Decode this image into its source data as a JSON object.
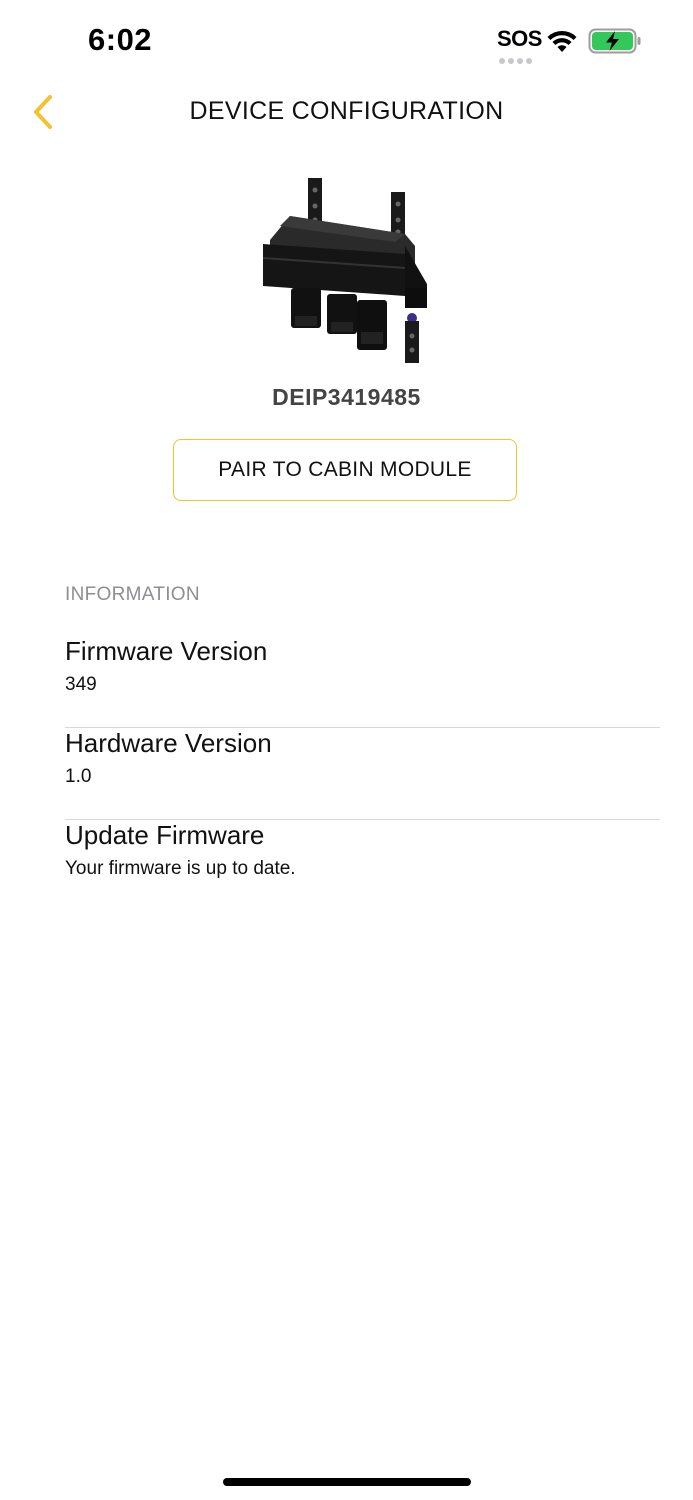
{
  "status_bar": {
    "time": "6:02",
    "carrier_label": "SOS",
    "icons": [
      "wifi-icon",
      "battery-charging-icon"
    ],
    "battery_color": "#34c759"
  },
  "nav": {
    "back_icon": "chevron-left-icon",
    "title": "DEVICE CONFIGURATION",
    "accent_color": "#f2c230"
  },
  "device": {
    "image_name": "control-module-image",
    "id": "DEIP3419485",
    "pair_button_label": "PAIR TO CABIN MODULE"
  },
  "information": {
    "header": "INFORMATION",
    "rows": [
      {
        "title": "Firmware Version",
        "value": "349"
      },
      {
        "title": "Hardware Version",
        "value": "1.0"
      },
      {
        "title": "Update Firmware",
        "value": "Your firmware is up to date."
      }
    ]
  }
}
